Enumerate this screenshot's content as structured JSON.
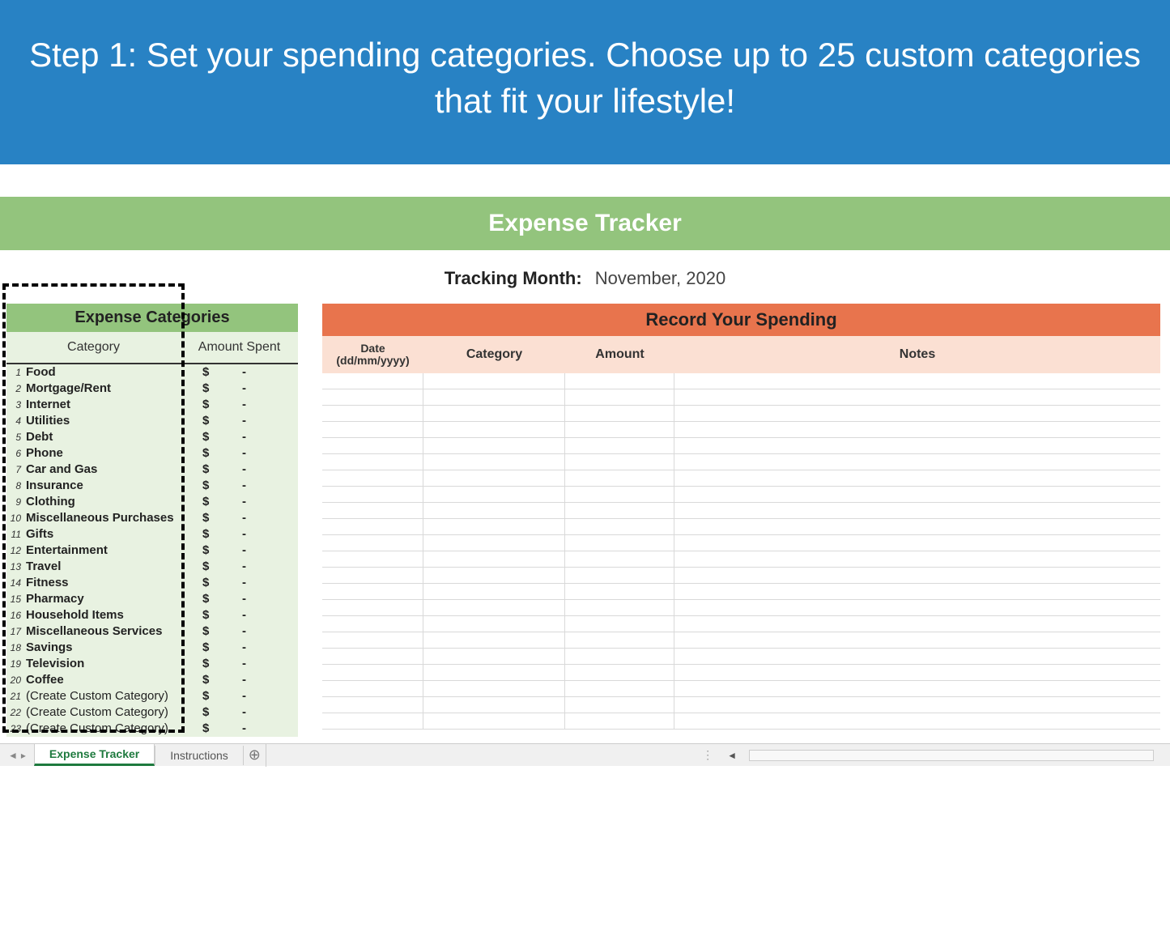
{
  "banner": {
    "line": "Step 1: Set your spending categories. Choose up to 25 custom categories that fit your lifestyle!"
  },
  "sheet": {
    "title_bar": "Expense Tracker",
    "tracking_label": "Tracking Month:",
    "tracking_value": "November, 2020"
  },
  "categories": {
    "panel_title": "Expense Categories",
    "col_category": "Category",
    "col_amount": "Amount Spent",
    "currency": "$",
    "dash": "-",
    "items": [
      {
        "n": "1",
        "name": "Food"
      },
      {
        "n": "2",
        "name": "Mortgage/Rent"
      },
      {
        "n": "3",
        "name": "Internet"
      },
      {
        "n": "4",
        "name": "Utilities"
      },
      {
        "n": "5",
        "name": "Debt"
      },
      {
        "n": "6",
        "name": "Phone"
      },
      {
        "n": "7",
        "name": "Car and Gas"
      },
      {
        "n": "8",
        "name": "Insurance"
      },
      {
        "n": "9",
        "name": "Clothing"
      },
      {
        "n": "10",
        "name": "Miscellaneous Purchases"
      },
      {
        "n": "11",
        "name": "Gifts"
      },
      {
        "n": "12",
        "name": "Entertainment"
      },
      {
        "n": "13",
        "name": "Travel"
      },
      {
        "n": "14",
        "name": "Fitness"
      },
      {
        "n": "15",
        "name": "Pharmacy"
      },
      {
        "n": "16",
        "name": "Household Items"
      },
      {
        "n": "17",
        "name": "Miscellaneous Services"
      },
      {
        "n": "18",
        "name": "Savings"
      },
      {
        "n": "19",
        "name": "Television"
      },
      {
        "n": "20",
        "name": "Coffee"
      },
      {
        "n": "21",
        "name": "(Create Custom Category)",
        "placeholder": true
      },
      {
        "n": "22",
        "name": "(Create Custom Category)",
        "placeholder": true
      },
      {
        "n": "23",
        "name": "(Create Custom Category)",
        "placeholder": true
      }
    ]
  },
  "record": {
    "panel_title": "Record Your Spending",
    "col_date_1": "Date",
    "col_date_2": "(dd/mm/yyyy)",
    "col_category": "Category",
    "col_amount": "Amount",
    "col_notes": "Notes",
    "empty_rows": 22
  },
  "tabs": {
    "active": "Expense Tracker",
    "inactive": "Instructions",
    "add": "⊕"
  }
}
